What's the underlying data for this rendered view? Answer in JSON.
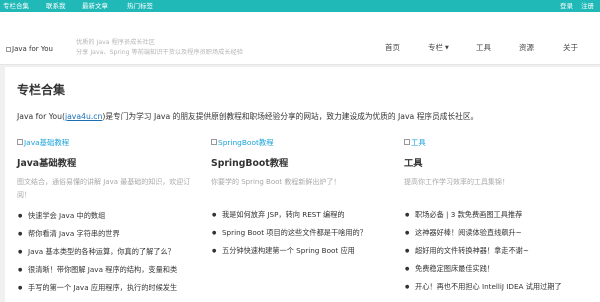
{
  "topbar": {
    "nav": [
      "专栏合集",
      "联系我",
      "最新文章",
      "热门标签"
    ],
    "right": [
      "登录",
      "注册"
    ]
  },
  "header": {
    "logo_text": "Java for You",
    "tagline": [
      "优质的 Java 程序员成长社区",
      "分享 Java、Spring 等前端知识干货以及程序员职场成长经验"
    ],
    "nav": [
      "首页",
      "专栏",
      "工具",
      "资源",
      "关于"
    ]
  },
  "main": {
    "title": "专栏合集",
    "intro_prefix": "Java for You(",
    "intro_link": "java4u.cn",
    "intro_suffix": ")是专门为学习 Java 的朋友提供原创教程和职场经验分享的网站，致力建设成为优质的 Java 程序员成长社区。",
    "columns": [
      {
        "img_alt": "Java基础教程",
        "title": "Java基础教程",
        "desc": "图文结合，通俗易懂的讲解 Java 最基础的知识，欢迎订阅！",
        "items": [
          "快速学会 Java 中的数组",
          "帮你看清 Java 字符串的世界",
          "Java 基本类型的各种运算，你真的了解了么？",
          "很清晰！带你图解 Java 程序的结构，变量和类",
          "手写的第一个 Java 应用程序，执行的时候发生"
        ]
      },
      {
        "img_alt": "SpringBoot教程",
        "title": "SpringBoot教程",
        "desc": "你要学的 Spring Boot 教程新鲜出炉了！",
        "items": [
          "我是如何放弃 JSP，转向 REST 编程的",
          "Spring Boot 项目的这些文件都是干啥用的？",
          "五分钟快速构建第一个 Spring Boot 应用"
        ]
      },
      {
        "img_alt": "工具",
        "title": "工具",
        "desc": "提高你工作学习效率的工具集锦！",
        "items": [
          "职场必备 | 3 款免费画图工具推荐",
          "这神器好棒！阅读体验直线飙升~",
          "超好用的文件转换神器！拿走不谢~",
          "免费稳定图床最佳实践！",
          "开心！再也不用担心 IntelliJ IDEA 试用过期了"
        ]
      }
    ]
  }
}
